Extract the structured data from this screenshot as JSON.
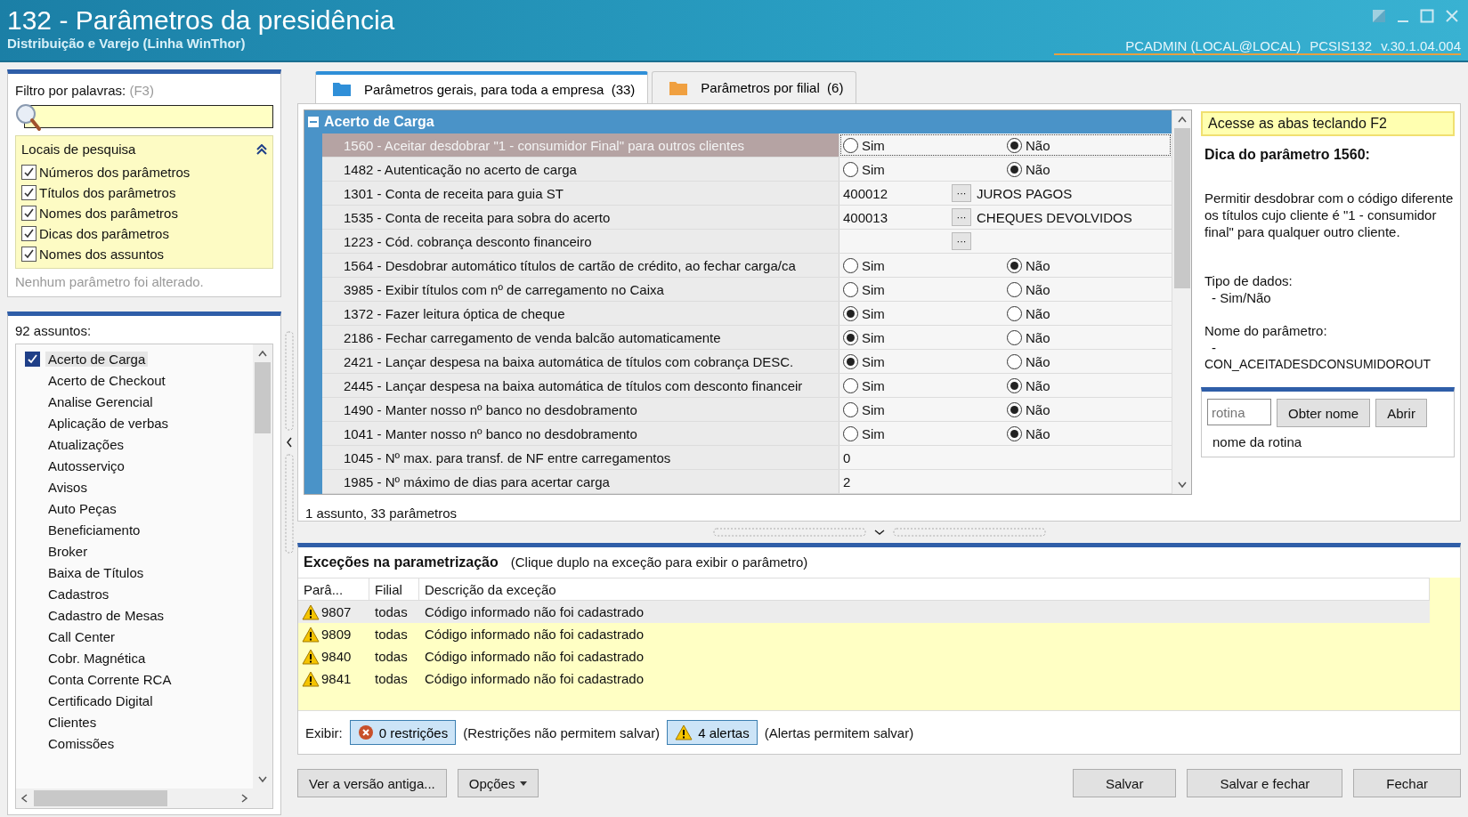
{
  "window": {
    "title": "132 - Parâmetros da presidência",
    "subtitle": "Distribuição e Varejo (Linha WinThor)",
    "user": "PCADMIN (LOCAL@LOCAL)",
    "routine": "PCSIS132",
    "version": "v.30.1.04.004"
  },
  "filter": {
    "label": "Filtro por palavras:",
    "shortcut": "(F3)",
    "search_places": {
      "title": "Locais de pesquisa",
      "expanded": true,
      "options": [
        {
          "label": "Números dos parâmetros",
          "checked": true
        },
        {
          "label": "Títulos dos parâmetros",
          "checked": true
        },
        {
          "label": "Nomes dos parâmetros",
          "checked": true
        },
        {
          "label": "Dicas dos parâmetros",
          "checked": true
        },
        {
          "label": "Nomes dos assuntos",
          "checked": true
        }
      ]
    },
    "status": "Nenhum parâmetro foi alterado."
  },
  "subjects": {
    "count_label": "92 assuntos:",
    "items": [
      {
        "label": "Acerto de Carga",
        "checked": true
      },
      {
        "label": "Acerto de Checkout",
        "checked": false
      },
      {
        "label": "Analise Gerencial",
        "checked": false
      },
      {
        "label": "Aplicação de verbas",
        "checked": false
      },
      {
        "label": "Atualizações",
        "checked": false
      },
      {
        "label": "Autosserviço",
        "checked": false
      },
      {
        "label": "Avisos",
        "checked": false
      },
      {
        "label": "Auto Peças",
        "checked": false
      },
      {
        "label": "Beneficiamento",
        "checked": false
      },
      {
        "label": "Broker",
        "checked": false
      },
      {
        "label": "Baixa de Títulos",
        "checked": false
      },
      {
        "label": "Cadastros",
        "checked": false
      },
      {
        "label": "Cadastro de Mesas",
        "checked": false
      },
      {
        "label": "Call Center",
        "checked": false
      },
      {
        "label": "Cobr. Magnética",
        "checked": false
      },
      {
        "label": "Conta Corrente RCA",
        "checked": false
      },
      {
        "label": "Certificado Digital",
        "checked": false
      },
      {
        "label": "Clientes",
        "checked": false
      },
      {
        "label": "Comissões",
        "checked": false
      }
    ]
  },
  "tabs": [
    {
      "label": "Parâmetros gerais, para toda a empresa",
      "count": "(33)",
      "selected": true,
      "color": "#2f8fd8"
    },
    {
      "label": "Parâmetros por filial",
      "count": "(6)",
      "selected": false,
      "color": "#f0a040"
    }
  ],
  "group": {
    "title": "Acerto de Carga",
    "expanded": true
  },
  "parameters": [
    {
      "label": "1560 - Aceitar desdobrar \"1 - consumidor Final\" para outros clientes",
      "kind": "yesno",
      "selected": true,
      "options": [
        {
          "label": "Sim",
          "selected": false
        },
        {
          "label": "Não",
          "selected": true
        }
      ]
    },
    {
      "label": "1482 - Autenticação no acerto de carga",
      "kind": "yesno",
      "selected": false,
      "options": [
        {
          "label": "Sim",
          "selected": false
        },
        {
          "label": "Não",
          "selected": true
        }
      ]
    },
    {
      "label": "1301 - Conta de receita para guia ST",
      "kind": "code",
      "selected": false,
      "value": "400012",
      "button": "···",
      "description": "JUROS PAGOS"
    },
    {
      "label": "1535 - Conta de receita para sobra do acerto",
      "kind": "code",
      "selected": false,
      "value": "400013",
      "button": "···",
      "description": "CHEQUES DEVOLVIDOS"
    },
    {
      "label": "1223 - Cód. cobrança desconto financeiro",
      "kind": "code",
      "selected": false,
      "button": "···"
    },
    {
      "label": "1564 - Desdobrar automático títulos de cartão de crédito, ao fechar carga/ca",
      "kind": "yesno",
      "selected": false,
      "options": [
        {
          "label": "Sim",
          "selected": false
        },
        {
          "label": "Não",
          "selected": true
        }
      ]
    },
    {
      "label": "3985 - Exibir títulos com nº de carregamento no Caixa",
      "kind": "yesno",
      "selected": false,
      "options": [
        {
          "label": "Sim",
          "selected": false
        },
        {
          "label": "Não",
          "selected": false
        }
      ]
    },
    {
      "label": "1372 - Fazer leitura óptica de cheque",
      "kind": "yesno",
      "selected": false,
      "options": [
        {
          "label": "Sim",
          "selected": true
        },
        {
          "label": "Não",
          "selected": false
        }
      ]
    },
    {
      "label": "2186 - Fechar carregamento de venda balcão automaticamente",
      "kind": "yesno",
      "selected": false,
      "options": [
        {
          "label": "Sim",
          "selected": true
        },
        {
          "label": "Não",
          "selected": false
        }
      ]
    },
    {
      "label": "2421 - Lançar despesa na baixa automática de títulos com cobrança DESC.",
      "kind": "yesno",
      "selected": false,
      "options": [
        {
          "label": "Sim",
          "selected": true
        },
        {
          "label": "Não",
          "selected": false
        }
      ]
    },
    {
      "label": "2445 - Lançar despesa na baixa automática de títulos com desconto financeir",
      "kind": "yesno",
      "selected": false,
      "options": [
        {
          "label": "Sim",
          "selected": false
        },
        {
          "label": "Não",
          "selected": true
        }
      ]
    },
    {
      "label": "1490 - Manter nosso nº banco no desdobramento",
      "kind": "yesno",
      "selected": false,
      "options": [
        {
          "label": "Sim",
          "selected": false
        },
        {
          "label": "Não",
          "selected": true
        }
      ]
    },
    {
      "label": "1041 - Manter nosso nº banco no desdobramento",
      "kind": "yesno",
      "selected": false,
      "options": [
        {
          "label": "Sim",
          "selected": false
        },
        {
          "label": "Não",
          "selected": true
        }
      ]
    },
    {
      "label": "1045 - Nº max. para transf. de NF entre carregamentos",
      "kind": "number",
      "selected": false,
      "value": "0"
    },
    {
      "label": "1985 - Nº máximo de dias para acertar carga",
      "kind": "number",
      "selected": false,
      "value": "2"
    }
  ],
  "grid_status": "1 assunto, 33 parâmetros",
  "hint": {
    "notice": "Acesse as abas teclando F2",
    "title": "Dica do parâmetro 1560:",
    "text": "Permitir desdobrar com o código diferente os títulos cujo cliente é \"1 - consumidor final\" para qualquer outro cliente.",
    "type_label": "Tipo de dados:",
    "type_value": "- Sim/Não",
    "name_label": "Nome do parâmetro:",
    "name_dash": "-",
    "name_value": "CON_ACEITADESDCONSUMIDOROUT"
  },
  "routine_lookup": {
    "placeholder": "rotina",
    "buttons": [
      "Obter nome",
      "Abrir"
    ],
    "result": "nome da rotina"
  },
  "exceptions": {
    "title": "Exceções na parametrização",
    "note": "(Clique duplo na exceção para exibir o parâmetro)",
    "columns": [
      "Parâ...",
      "Filial",
      "Descrição da exceção"
    ],
    "rows": [
      {
        "param": "9807",
        "branch": "todas",
        "description": "Código informado não foi cadastrado",
        "selected": true
      },
      {
        "param": "9809",
        "branch": "todas",
        "description": "Código informado não foi cadastrado",
        "selected": false
      },
      {
        "param": "9840",
        "branch": "todas",
        "description": "Código informado não foi cadastrado",
        "selected": false
      },
      {
        "param": "9841",
        "branch": "todas",
        "description": "Código informado não foi cadastrado",
        "selected": false
      }
    ],
    "show_label": "Exibir:",
    "toggles": [
      {
        "kind": "error",
        "label": "0 restrições",
        "note": "(Restrições não permitem salvar)",
        "selected": true
      },
      {
        "kind": "warning",
        "label": "4 alertas",
        "note": "(Alertas permitem salvar)",
        "selected": true
      }
    ]
  },
  "footer": {
    "left_buttons": [
      {
        "label": "Ver a versão antiga...",
        "dropdown": false
      },
      {
        "label": "Opções",
        "dropdown": true
      }
    ],
    "right_buttons": [
      "Salvar",
      "Salvar e fechar",
      "Fechar"
    ]
  }
}
